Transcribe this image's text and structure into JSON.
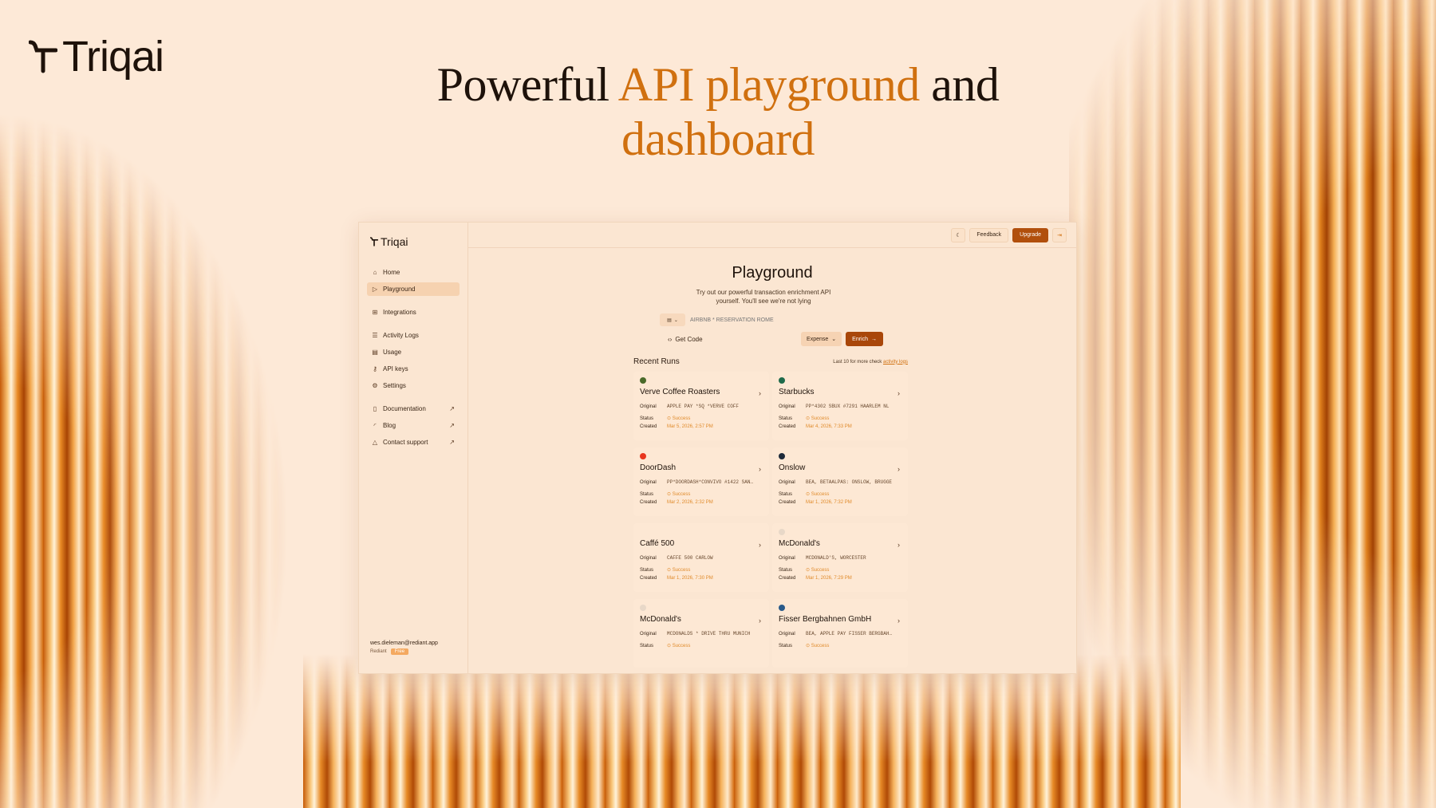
{
  "brand": {
    "name": "Triqai"
  },
  "headline": {
    "part1": "Powerful ",
    "accent1": "API playground",
    "part2": " and",
    "accent2": "dashboard"
  },
  "app": {
    "sidebar": {
      "logo": "Triqai",
      "nav_primary": [
        {
          "label": "Home",
          "icon": "home-icon"
        },
        {
          "label": "Playground",
          "icon": "play-icon",
          "active": true
        },
        {
          "label": "Integrations",
          "icon": "grid-icon"
        }
      ],
      "nav_secondary": [
        {
          "label": "Activity Logs",
          "icon": "list-icon"
        },
        {
          "label": "Usage",
          "icon": "chart-icon"
        },
        {
          "label": "API keys",
          "icon": "key-icon"
        },
        {
          "label": "Settings",
          "icon": "gear-icon"
        }
      ],
      "nav_external": [
        {
          "label": "Documentation",
          "icon": "book-icon"
        },
        {
          "label": "Blog",
          "icon": "rss-icon"
        },
        {
          "label": "Contact support",
          "icon": "bell-icon"
        }
      ],
      "user": {
        "email": "wes.dieleman@rediant.app",
        "org": "Rediant",
        "plan": "Free"
      }
    },
    "topbar": {
      "feedback": "Feedback",
      "upgrade": "Upgrade"
    },
    "playground": {
      "title": "Playground",
      "subtitle": "Try out our powerful transaction enrichment API yourself. You'll see we're not lying",
      "input_placeholder": "AIRBNB * RESERVATION ROME",
      "get_code": "Get Code",
      "type_value": "Expense",
      "enrich_label": "Enrich"
    },
    "recent": {
      "title": "Recent Runs",
      "note_prefix": "Last 10 for more check ",
      "note_link": "activity logs",
      "labels": {
        "original": "Original",
        "status": "Status",
        "created": "Created"
      },
      "runs": [
        {
          "merchant": "Verve Coffee Roasters",
          "original": "APPLE PAY *SQ *VERVE COFF",
          "status": "Success",
          "created": "Mar 5, 2026, 2:57 PM",
          "logo_color": "#4a6a2a"
        },
        {
          "merchant": "Starbucks",
          "original": "PP*4302 SBUX #7291 HAARLEM NL",
          "status": "Success",
          "created": "Mar 4, 2026, 7:33 PM",
          "logo_color": "#1e6a4a"
        },
        {
          "merchant": "DoorDash",
          "original": "PP*DOORDASH*CONVIVO #1422 SAN…",
          "status": "Success",
          "created": "Mar 2, 2026, 2:32 PM",
          "logo_color": "#e8361e"
        },
        {
          "merchant": "Onslow",
          "original": "BEA, BETAALPAS: ONSLOW, BRUGGE",
          "status": "Success",
          "created": "Mar 1, 2026, 7:32 PM",
          "logo_color": "#1e2a3a"
        },
        {
          "merchant": "Caffé 500",
          "original": "CAFFE 500 CARLOW",
          "status": "Success",
          "created": "Mar 1, 2026, 7:30 PM",
          "logo_color": ""
        },
        {
          "merchant": "McDonald's",
          "original": "MCDONALD'S, WORCESTER",
          "status": "Success",
          "created": "Mar 1, 2026, 7:29 PM",
          "logo_color": "#e8d8c8"
        },
        {
          "merchant": "McDonald's",
          "original": "MCDONALDS * DRIVE THRU MUNICH",
          "status": "Success",
          "created": "",
          "logo_color": "#e8d8c8"
        },
        {
          "merchant": "Fisser Bergbahnen GmbH",
          "original": "BEA, APPLE PAY FISSER BERGBAH…",
          "status": "Success",
          "created": "",
          "logo_color": "#2a5a8a"
        }
      ]
    }
  }
}
